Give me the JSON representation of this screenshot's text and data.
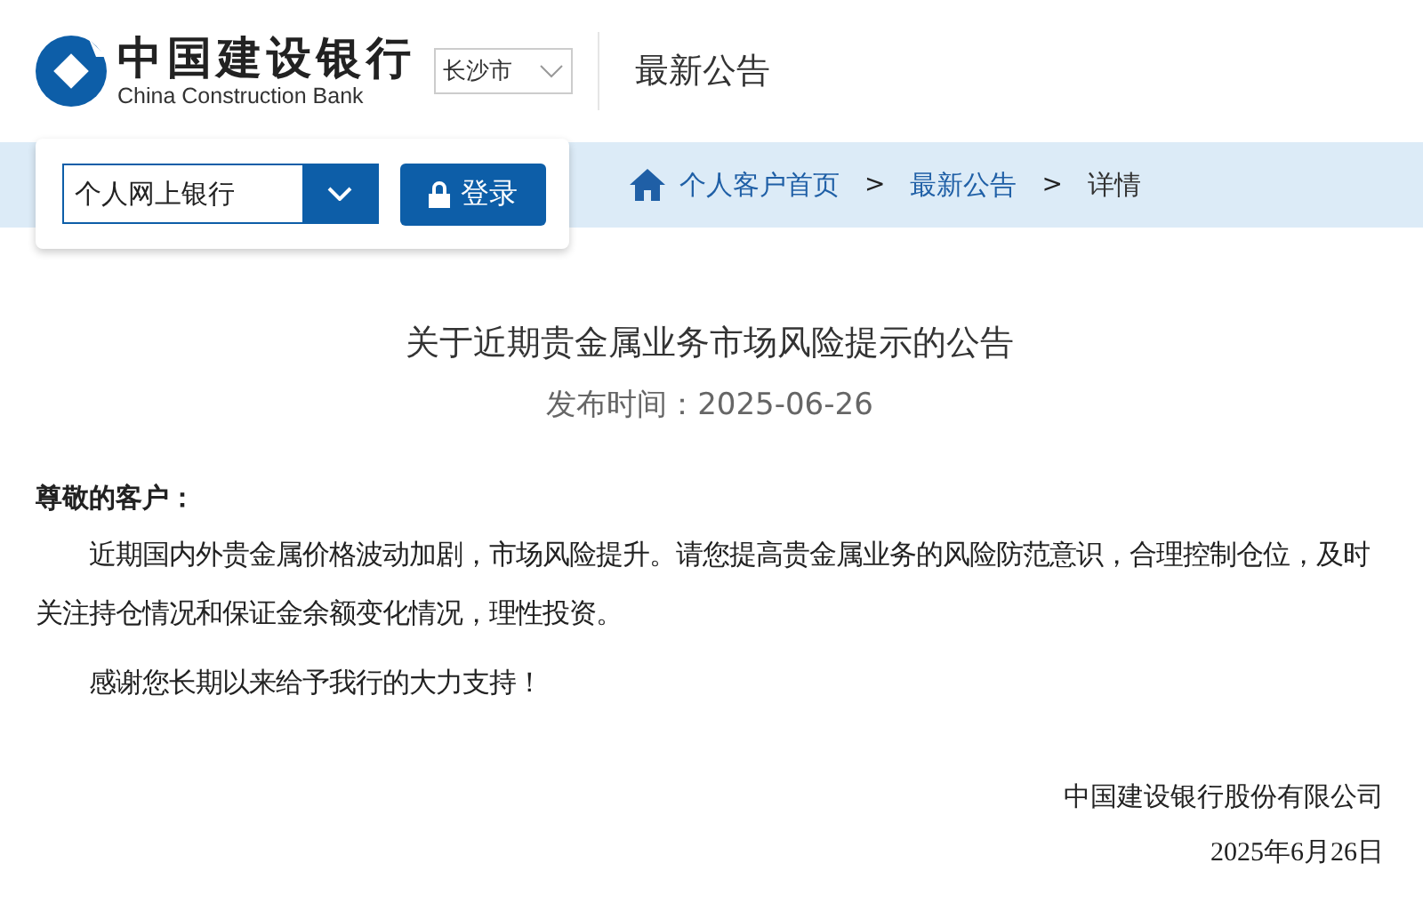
{
  "header": {
    "logo_cn": "中国建设银行",
    "logo_en": "China Construction Bank",
    "city": "长沙市",
    "section": "最新公告"
  },
  "login": {
    "channel": "个人网上银行",
    "button": "登录"
  },
  "breadcrumb": [
    {
      "label": "个人客户首页",
      "kind": "link"
    },
    {
      "label": "最新公告",
      "kind": "link"
    },
    {
      "label": "详情",
      "kind": "current"
    }
  ],
  "separator": ">",
  "article": {
    "title": "关于近期贵金属业务市场风险提示的公告",
    "date": "发布时间：2025-06-26",
    "greeting": "尊敬的客户：",
    "paragraphs": [
      "近期国内外贵金属价格波动加剧，市场风险提升。请您提高贵金属业务的风险防范意识，合理控制仓位，及时关注持仓情况和保证金余额变化情况，理性投资。",
      "感谢您长期以来给予我行的大力支持！"
    ],
    "signature": "中国建设银行股份有限公司",
    "sign_date": "2025年6月26日"
  }
}
